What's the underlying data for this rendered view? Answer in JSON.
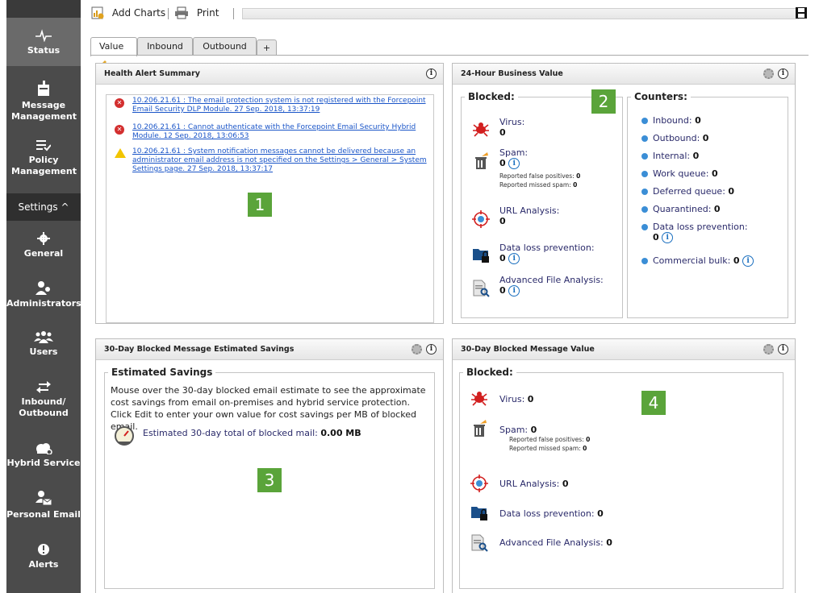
{
  "sidebar": {
    "items": [
      {
        "label": "Status",
        "icon": "pulse-icon"
      },
      {
        "label": "Message Management",
        "icon": "mailbox-icon"
      },
      {
        "label": "Policy Management",
        "icon": "list-icon"
      },
      {
        "label": "Settings ^",
        "icon": ""
      },
      {
        "label": "General",
        "icon": "gear-icon"
      },
      {
        "label": "Administrators",
        "icon": "admin-icon"
      },
      {
        "label": "Users",
        "icon": "users-icon"
      },
      {
        "label": "Inbound/ Outbound",
        "icon": "arrows-icon"
      },
      {
        "label": "Hybrid Service",
        "icon": "cloud-icon"
      },
      {
        "label": "Personal Email",
        "icon": "person-mail-icon"
      },
      {
        "label": "Alerts",
        "icon": "alert-icon"
      }
    ]
  },
  "toolbar": {
    "add_charts": "Add Charts",
    "print": "Print"
  },
  "tabs": [
    "Value",
    "Inbound",
    "Outbound",
    "+"
  ],
  "health": {
    "title": "Health Alert Summary",
    "alerts": [
      {
        "type": "error",
        "text": "10.206.21.61 : The email protection system is not registered with the Forcepoint Email Security DLP Module.    27 Sep. 2018, 13:37:19"
      },
      {
        "type": "error",
        "text": "10.206.21.61 : Cannot authenticate with the Forcepoint Email Security Hybrid Module.    12 Sep. 2018, 13:06:53"
      },
      {
        "type": "warning",
        "text": "10.206.21.61 : System notification messages cannot be delivered because an administrator email address is not specified on the Settings > General > System Settings page.    27 Sep. 2018, 13:37:17"
      }
    ],
    "callout": "1"
  },
  "business": {
    "title": "24-Hour Business Value",
    "blocked_legend": "Blocked:",
    "counters_legend": "Counters:",
    "callout": "2",
    "virus_label": "Virus:",
    "virus_value": "0",
    "spam_label": "Spam:",
    "spam_value": "0",
    "false_pos": "Reported false positives: ",
    "false_pos_value": "0",
    "missed_spam": "Reported missed spam: ",
    "missed_spam_value": "0",
    "url_label": "URL Analysis:",
    "url_value": "0",
    "dlp_label": "Data loss prevention:",
    "dlp_value": "0",
    "afa_label": "Advanced File Analysis:",
    "afa_value": "0",
    "counters": [
      {
        "label": "Inbound: ",
        "value": "0"
      },
      {
        "label": "Outbound: ",
        "value": "0"
      },
      {
        "label": "Internal: ",
        "value": "0"
      },
      {
        "label": "Work queue: ",
        "value": "0"
      },
      {
        "label": "Deferred queue: ",
        "value": "0"
      },
      {
        "label": "Quarantined: ",
        "value": "0"
      },
      {
        "label": "Data loss prevention:",
        "value": "0"
      },
      {
        "label": "Commercial bulk: ",
        "value": "0"
      }
    ]
  },
  "savings": {
    "title": "30-Day Blocked Message Estimated Savings",
    "legend": "Estimated Savings",
    "line1": "Mouse over the 30-day blocked email estimate to see the approximate cost savings from email on-premises and hybrid service protection.",
    "line2": "Click Edit to enter your own value for cost savings per MB of blocked email.",
    "total_label": "Estimated 30-day total of blocked mail: ",
    "total_value": "0.00 MB",
    "callout": "3"
  },
  "value30": {
    "title": "30-Day Blocked Message Value",
    "legend": "Blocked:",
    "callout": "4",
    "virus_label": "Virus: ",
    "virus_value": "0",
    "spam_label": "Spam: ",
    "spam_value": "0",
    "false_pos": "Reported false positives: ",
    "false_pos_value": "0",
    "missed_spam": "Reported missed spam: ",
    "missed_spam_value": "0",
    "url_label": "URL Analysis: ",
    "url_value": "0",
    "dlp_label": "Data loss prevention: ",
    "dlp_value": "0",
    "afa_label": "Advanced File Analysis: ",
    "afa_value": "0"
  }
}
